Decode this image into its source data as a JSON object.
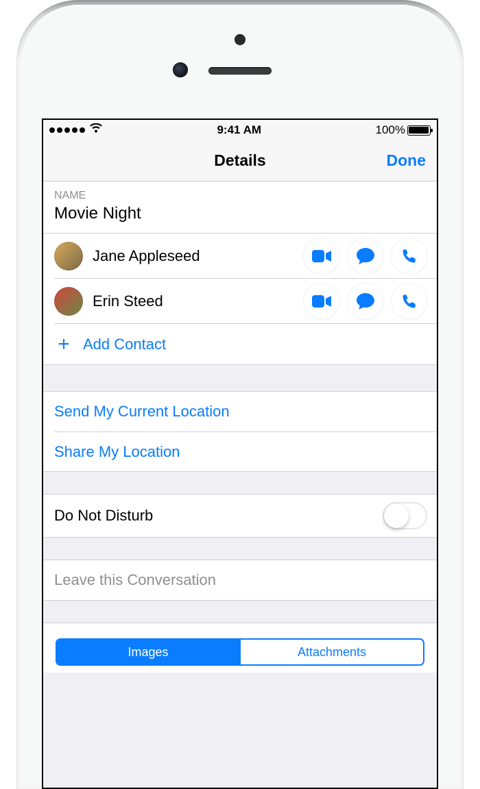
{
  "status": {
    "time": "9:41 AM",
    "battery": "100%"
  },
  "nav": {
    "title": "Details",
    "done": "Done"
  },
  "name_section": {
    "header": "NAME",
    "value": "Movie Night"
  },
  "contacts": [
    {
      "name": "Jane Appleseed"
    },
    {
      "name": "Erin Steed"
    }
  ],
  "add_contact": "Add Contact",
  "location": {
    "send": "Send My Current Location",
    "share": "Share My Location"
  },
  "dnd": "Do Not Disturb",
  "leave": "Leave this Conversation",
  "tabs": {
    "images": "Images",
    "attachments": "Attachments"
  }
}
